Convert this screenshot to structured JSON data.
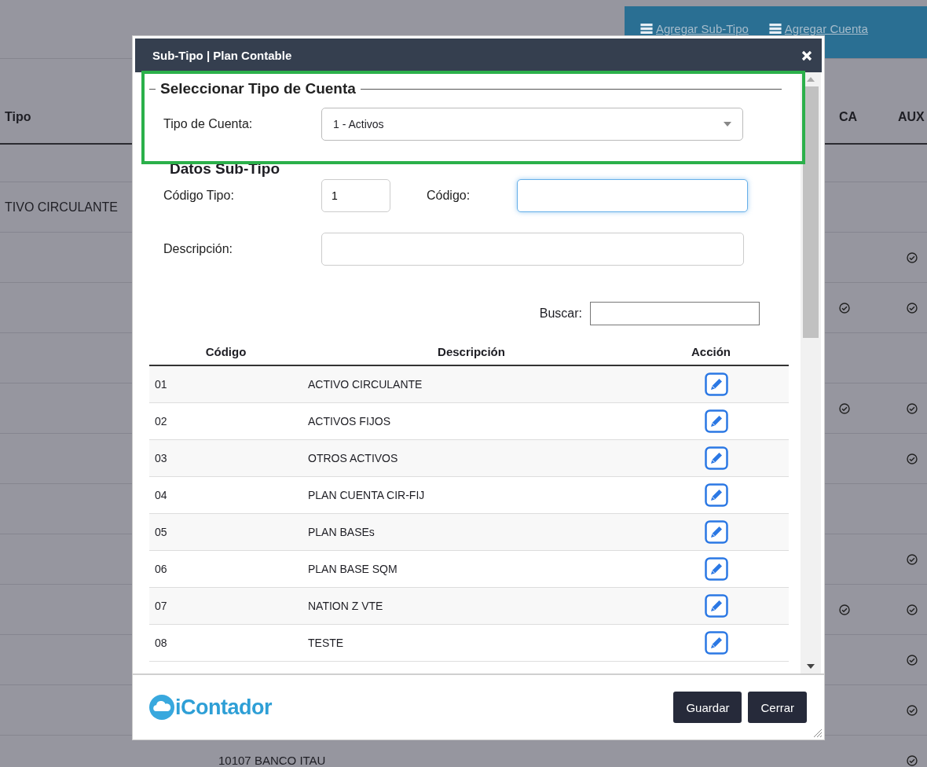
{
  "background": {
    "toolbar": [
      {
        "label": "Agregar Sub-Tipo"
      },
      {
        "label": "Agregar Cuenta"
      }
    ],
    "columns": [
      "Tipo",
      "CA",
      "AUX"
    ],
    "rows": [
      {
        "tipo": "",
        "column_2": "",
        "ca": false,
        "aux": false
      },
      {
        "tipo": "TIVO CIRCULANTE",
        "column_2": "",
        "ca": false,
        "aux": false
      },
      {
        "tipo": "",
        "column_2": "",
        "ca": false,
        "aux": true
      },
      {
        "tipo": "",
        "column_2": "",
        "ca": true,
        "aux": true
      },
      {
        "tipo": "",
        "column_2": "",
        "ca": false,
        "aux": false
      },
      {
        "tipo": "",
        "column_2": "",
        "ca": true,
        "aux": true
      },
      {
        "tipo": "",
        "column_2": "",
        "ca": false,
        "aux": true
      },
      {
        "tipo": "",
        "column_2": "",
        "ca": false,
        "aux": false
      },
      {
        "tipo": "",
        "column_2": "",
        "ca": false,
        "aux": true
      },
      {
        "tipo": "",
        "column_2": "",
        "ca": true,
        "aux": true
      },
      {
        "tipo": "",
        "column_2": "",
        "ca": false,
        "aux": true
      },
      {
        "tipo": "",
        "column_2": "",
        "ca": false,
        "aux": true
      },
      {
        "tipo": "",
        "column_2": "10107 BANCO ITAU",
        "ca": false,
        "aux": true
      }
    ]
  },
  "modal": {
    "title": "Sub-Tipo | Plan Contable",
    "select_section": {
      "legend": "Seleccionar Tipo de Cuenta",
      "label": "Tipo de Cuenta:",
      "value": "1 - Activos"
    },
    "data_section": {
      "legend": "Datos Sub-Tipo",
      "codigo_tipo": {
        "label": "Código Tipo:",
        "value": "1"
      },
      "codigo": {
        "label": "Código:",
        "focused": true
      },
      "descripcion": {
        "label": "Descripción:"
      }
    },
    "search": {
      "label": "Buscar:"
    },
    "table": {
      "columns": [
        "Código",
        "Descripción",
        "Acción"
      ],
      "rows": [
        {
          "codigo": "01",
          "descripcion": "ACTIVO CIRCULANTE"
        },
        {
          "codigo": "02",
          "descripcion": "ACTIVOS FIJOS"
        },
        {
          "codigo": "03",
          "descripcion": "OTROS ACTIVOS"
        },
        {
          "codigo": "04",
          "descripcion": "PLAN CUENTA CIR-FIJ"
        },
        {
          "codigo": "05",
          "descripcion": "PLAN BASEs"
        },
        {
          "codigo": "06",
          "descripcion": "PLAN BASE SQM"
        },
        {
          "codigo": "07",
          "descripcion": "NATION Z VTE"
        },
        {
          "codigo": "08",
          "descripcion": "TESTE"
        }
      ]
    },
    "logo": "iContador",
    "buttons": [
      "Guardar",
      "Cerrar"
    ]
  }
}
